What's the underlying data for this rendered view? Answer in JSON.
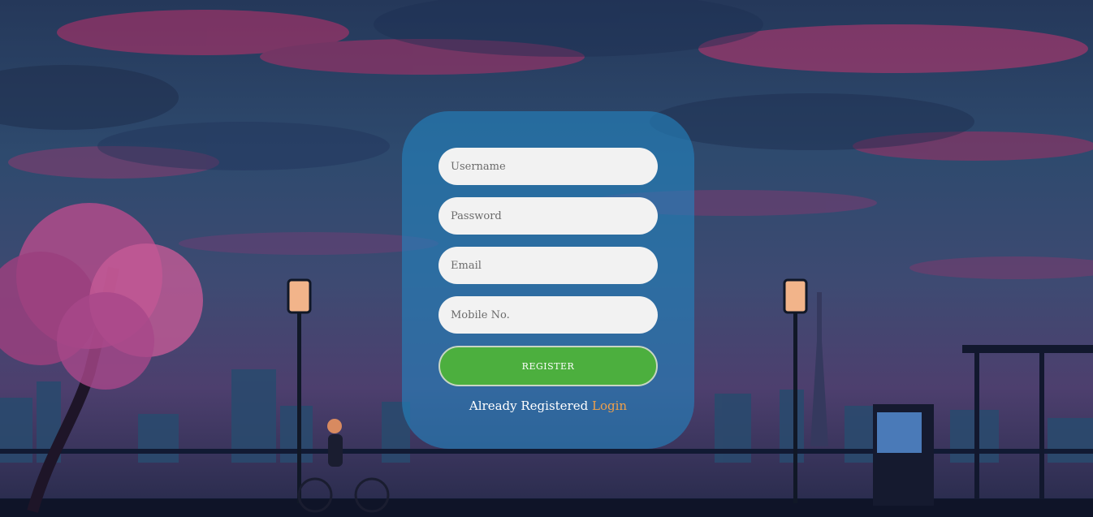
{
  "form": {
    "username_placeholder": "Username",
    "password_placeholder": "Password",
    "email_placeholder": "Email",
    "mobile_placeholder": "Mobile No.",
    "register_label": "REGISTER",
    "already_text": "Already Registered",
    "login_label": "Login"
  },
  "colors": {
    "card": "#2382be",
    "button": "#4caf3e",
    "link": "#f0a04a"
  }
}
